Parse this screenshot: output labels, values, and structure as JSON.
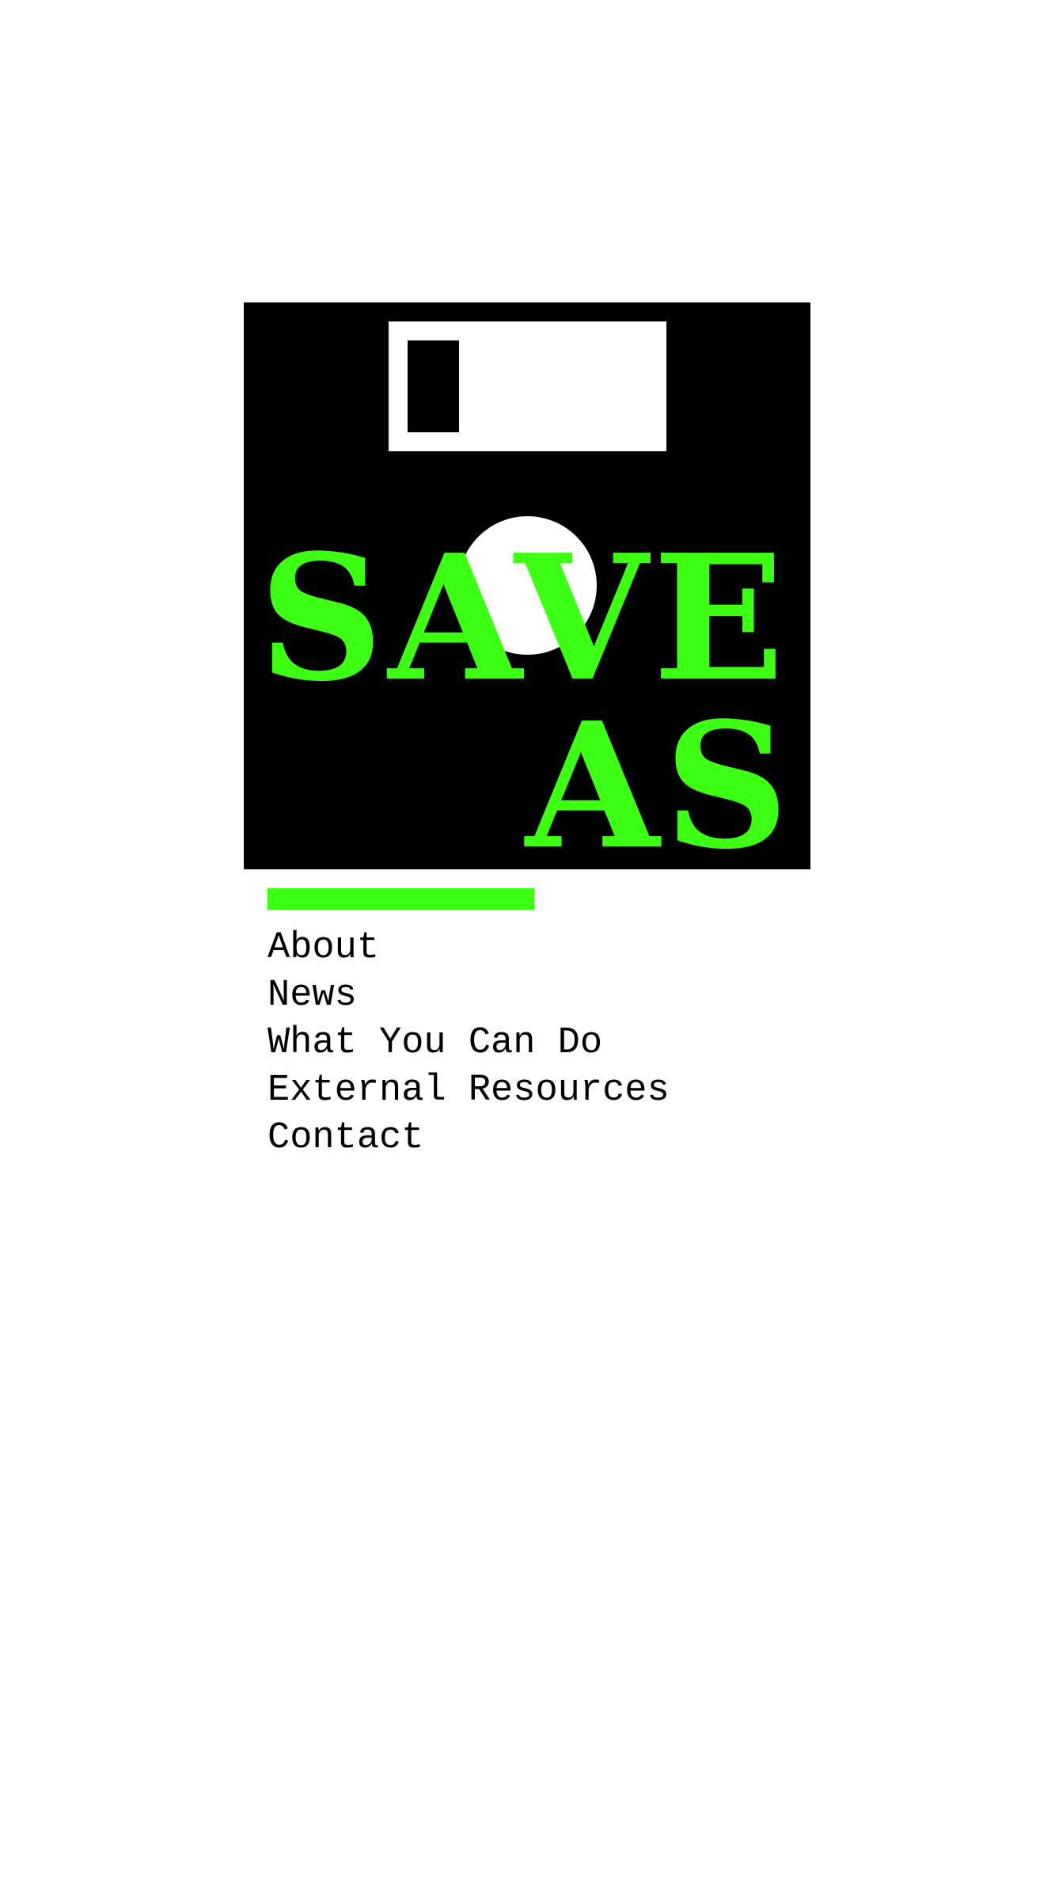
{
  "logo": {
    "line1": "SAVE",
    "line2": "AS",
    "icon": "floppy-disk-icon"
  },
  "colors": {
    "accent": "#3cff14",
    "logo_background": "#000000",
    "text": "#000000",
    "page_background": "#ffffff"
  },
  "nav": {
    "items": [
      {
        "label": "About"
      },
      {
        "label": "News"
      },
      {
        "label": "What You Can Do"
      },
      {
        "label": "External Resources"
      },
      {
        "label": "Contact"
      }
    ]
  }
}
